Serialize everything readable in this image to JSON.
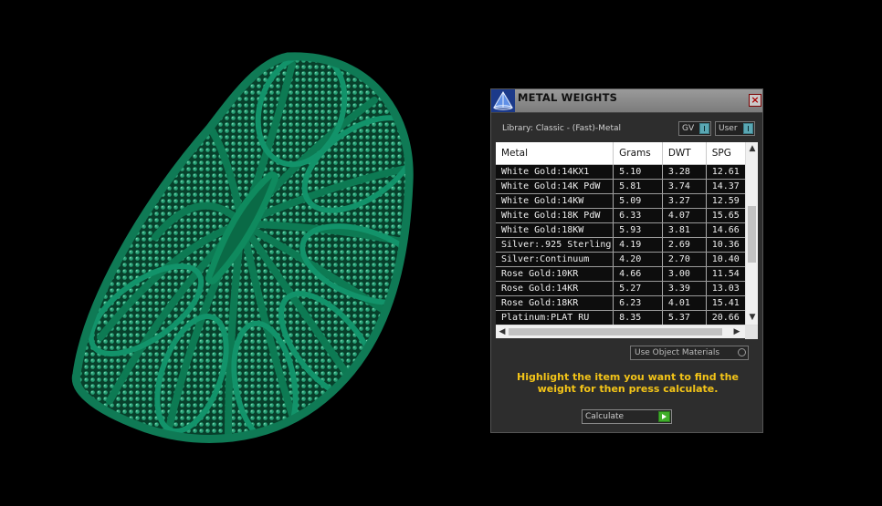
{
  "dialog": {
    "title": "METAL WEIGHTS",
    "close_glyph": "×",
    "logo_icon": "app-pyramid-icon",
    "library_label": "Library: Classic - (Fast)-Metal",
    "gv_toggle_label": "GV",
    "user_toggle_label": "User",
    "table": {
      "columns": [
        "Metal",
        "Grams",
        "DWT",
        "SPG"
      ],
      "rows": [
        {
          "metal": "White Gold:14KX1",
          "grams": "5.10",
          "dwt": "3.28",
          "spg": "12.61"
        },
        {
          "metal": "White Gold:14K PdW",
          "grams": "5.81",
          "dwt": "3.74",
          "spg": "14.37"
        },
        {
          "metal": "White Gold:14KW",
          "grams": "5.09",
          "dwt": "3.27",
          "spg": "12.59"
        },
        {
          "metal": "White Gold:18K PdW",
          "grams": "6.33",
          "dwt": "4.07",
          "spg": "15.65"
        },
        {
          "metal": "White Gold:18KW",
          "grams": "5.93",
          "dwt": "3.81",
          "spg": "14.66"
        },
        {
          "metal": "Silver:.925 Sterling",
          "grams": "4.19",
          "dwt": "2.69",
          "spg": "10.36"
        },
        {
          "metal": "Silver:Continuum",
          "grams": "4.20",
          "dwt": "2.70",
          "spg": "10.40"
        },
        {
          "metal": "Rose Gold:10KR",
          "grams": "4.66",
          "dwt": "3.00",
          "spg": "11.54"
        },
        {
          "metal": "Rose Gold:14KR",
          "grams": "5.27",
          "dwt": "3.39",
          "spg": "13.03"
        },
        {
          "metal": "Rose Gold:18KR",
          "grams": "6.23",
          "dwt": "4.01",
          "spg": "15.41"
        },
        {
          "metal": "Platinum:PLAT RU",
          "grams": "8.35",
          "dwt": "5.37",
          "spg": "20.66"
        }
      ]
    },
    "use_object_materials_label": "Use Object Materials",
    "instructions": "Highlight the item you want to find the weight for then press calculate.",
    "calculate_label": "Calculate",
    "colors": {
      "accent_text": "#f3c418",
      "toggle_knob": "#5aa7b3",
      "go_button": "#3fae2a",
      "model_green": "#0f7a55"
    }
  }
}
